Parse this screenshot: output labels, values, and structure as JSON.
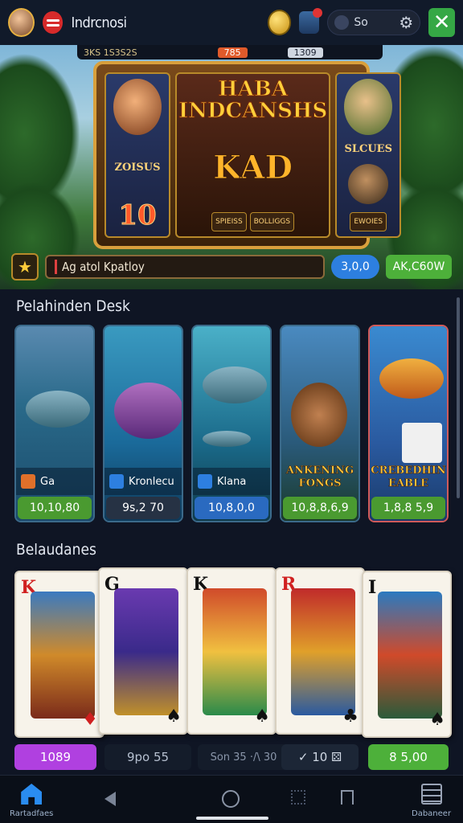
{
  "header": {
    "app_title": "Indrcnosi",
    "search_text": "So",
    "close_label": "✕"
  },
  "hero": {
    "topbar": {
      "left": "3KS  1S3S2S",
      "chip_a": "785",
      "chip_b": "1309"
    },
    "title": "HABA INDCANSHS",
    "big_letters": "KAD",
    "left_reel_label": "ZOISUS",
    "left_reel_number": "10",
    "right_reel_label": "SLCUES",
    "mini_labels": [
      "SPIEISS",
      "BOLLIGGS",
      "EWOIES"
    ],
    "jackpot_text": "Ag atol Kpatloy",
    "pill_blue": "3,0,0",
    "pill_green": "AK,C60W"
  },
  "section1": {
    "title": "Pelahinden Desk"
  },
  "fish_cards": [
    {
      "label": "Ga",
      "price": "10,10,80",
      "icon": "orange-badge-icon",
      "price_style": "green"
    },
    {
      "label": "Kronlecu",
      "price": "9s,2 70",
      "icon": "blue-badge-icon",
      "price_style": "dark"
    },
    {
      "label": "Klana",
      "price": "10,8,0,0",
      "icon": "blue-badge-icon",
      "price_style": "blue"
    },
    {
      "big_label": "ANKENING FONGS",
      "price": "10,8,8,6,9",
      "price_style": "green"
    },
    {
      "big_label": "CREBEDHIN EABLE",
      "price": "1,8,8 5,9",
      "price_style": "green"
    }
  ],
  "section2": {
    "title": "Belaudanes"
  },
  "cards": [
    {
      "rank": "K",
      "suit": "♦",
      "color": "red"
    },
    {
      "rank": "G",
      "suit": "♠",
      "color": "black"
    },
    {
      "rank": "K",
      "suit": "♠",
      "color": "black"
    },
    {
      "rank": "R",
      "suit": "♣",
      "color": "red"
    },
    {
      "rank": "I",
      "suit": "♠",
      "color": "black"
    }
  ],
  "buttons": [
    {
      "label": "1089"
    },
    {
      "label": "9po 55"
    },
    {
      "label": "Son 35 ·/\\ 30"
    },
    {
      "label": "✓  10  ⚄"
    },
    {
      "label": "8  5,00"
    }
  ],
  "nav": {
    "home_label": "Rartadfaes",
    "list_label": "Dabaneer"
  },
  "colors": {
    "accent_green": "#4db03a",
    "accent_blue": "#2d7fe0",
    "purple": "#b040e0",
    "bg": "#0f1524"
  }
}
